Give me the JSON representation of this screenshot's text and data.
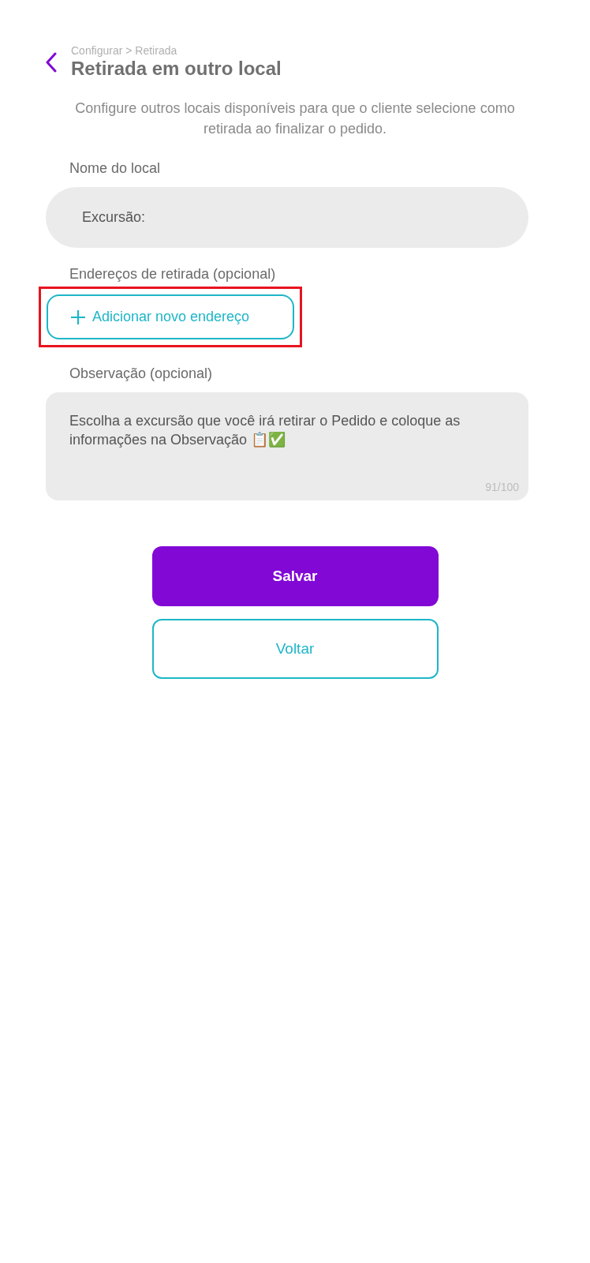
{
  "header": {
    "breadcrumb": "Configurar > Retirada",
    "title": "Retirada em outro local"
  },
  "description": "Configure outros locais disponíveis para que o cliente selecione como retirada ao finalizar o pedido.",
  "name_field": {
    "label": "Nome do local",
    "value": "Excursão:"
  },
  "addresses": {
    "label": "Endereços de retirada (opcional)",
    "add_button": {
      "label": "Adicionar novo endereço",
      "highlighted": true
    }
  },
  "note_field": {
    "label": "Observação (opcional)",
    "value": "Escolha a excursão que você irá retirar o Pedido e coloque as informações na Observação 📋✅",
    "counter": "91/100"
  },
  "buttons": [
    {
      "label": "Salvar",
      "kind": "primary"
    },
    {
      "label": "Voltar",
      "kind": "secondary"
    }
  ]
}
